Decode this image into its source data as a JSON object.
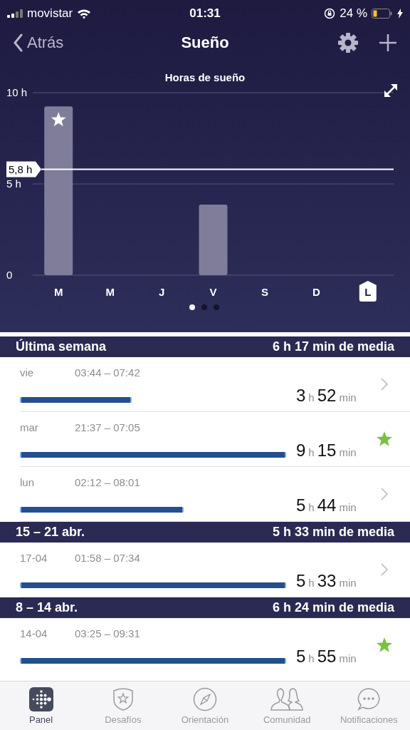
{
  "status_bar": {
    "carrier": "movistar",
    "time": "01:31",
    "battery": "24 %"
  },
  "nav": {
    "back": "Atrás",
    "title": "Sueño"
  },
  "chart": {
    "title": "Horas de sueño",
    "day_states": [
      {
        "selected": false,
        "starred": true
      },
      {
        "selected": false,
        "starred": false
      },
      {
        "selected": false,
        "starred": false
      },
      {
        "selected": false,
        "starred": false
      },
      {
        "selected": false,
        "starred": false
      },
      {
        "selected": false,
        "starred": false
      },
      {
        "selected": true,
        "starred": false
      }
    ],
    "chart_data": {
      "type": "bar",
      "categories": [
        "M",
        "M",
        "J",
        "V",
        "S",
        "D",
        "L"
      ],
      "values": [
        9.25,
        null,
        null,
        3.87,
        null,
        null,
        null
      ],
      "ylim": [
        0,
        10
      ],
      "yticks": [
        {
          "value": 0,
          "label": "0"
        },
        {
          "value": 5,
          "label": "5 h"
        },
        {
          "value": 10,
          "label": "10 h"
        }
      ],
      "ref_lines": [
        {
          "axis": "y",
          "value": 5.8,
          "label": "5,8 h"
        }
      ]
    },
    "pager": [
      {
        "selected": true
      },
      {
        "selected": false
      },
      {
        "selected": false
      }
    ]
  },
  "sections": [
    {
      "title": "Última semana",
      "average": "6 h 17 min de media",
      "entries": [
        {
          "day": "vie",
          "range": "03:44 – 07:42",
          "hours": "3",
          "hours_unit": "h",
          "minutes": "52",
          "minutes_unit": "min",
          "starred": false
        },
        {
          "day": "mar",
          "range": "21:37 – 07:05",
          "hours": "9",
          "hours_unit": "h",
          "minutes": "15",
          "minutes_unit": "min",
          "starred": true
        },
        {
          "day": "lun",
          "range": "02:12 – 08:01",
          "hours": "5",
          "hours_unit": "h",
          "minutes": "44",
          "minutes_unit": "min",
          "starred": false
        }
      ]
    },
    {
      "title": "15 – 21 abr.",
      "average": "5 h 33 min de media",
      "entries": [
        {
          "day": "17-04",
          "range": "01:58 – 07:34",
          "hours": "5",
          "hours_unit": "h",
          "minutes": "33",
          "minutes_unit": "min",
          "starred": false
        }
      ]
    },
    {
      "title": "8 – 14 abr.",
      "average": "6 h 24 min de media",
      "entries": [
        {
          "day": "14-04",
          "range": "03:25 – 09:31",
          "hours": "5",
          "hours_unit": "h",
          "minutes": "55",
          "minutes_unit": "min",
          "starred": true
        }
      ]
    }
  ],
  "tab_bar": [
    {
      "label": "Panel",
      "selected": true
    },
    {
      "label": "Desafíos",
      "selected": false
    },
    {
      "label": "Orientación",
      "selected": false
    },
    {
      "label": "Comunidad",
      "selected": false
    },
    {
      "label": "Notificaciones",
      "selected": false
    }
  ]
}
